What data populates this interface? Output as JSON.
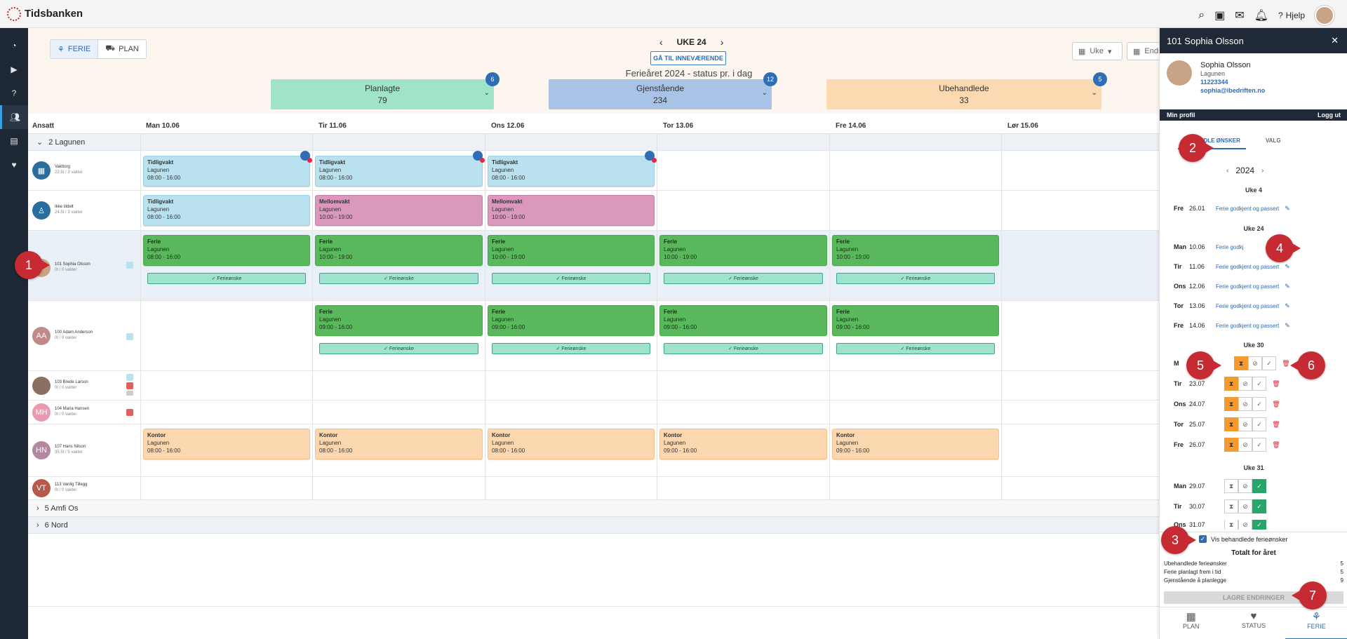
{
  "app": {
    "brand": "Tidsbanken",
    "help": "Hjelp"
  },
  "toolbar": {
    "ferie": "FERIE",
    "plan": "PLAN",
    "week": "UKE 24",
    "goto": "GÅ TIL INNEVÆRENDE",
    "heading": "Ferieåret 2024 - status pr. i dag",
    "view_select": "Uke",
    "end_select": "Ends"
  },
  "stats": [
    {
      "label": "Planlagte",
      "value": "79",
      "badge": "6",
      "color": "#9fe3c9"
    },
    {
      "label": "Gjenstående",
      "value": "234",
      "badge": "12",
      "color": "#a9c3e6"
    },
    {
      "label": "Ubehandlede",
      "value": "33",
      "badge": "5",
      "color": "#fcd9b0"
    }
  ],
  "grid": {
    "col_employee": "Ansatt",
    "days": [
      "Man 10.06",
      "Tir 11.06",
      "Ons 12.06",
      "Tor 13.06",
      "Fre 14.06",
      "Lør 15.06"
    ],
    "groups": [
      "2 Lagunen",
      "5 Amfi Os",
      "6 Nord"
    ],
    "wish": "Ferieønske",
    "employees": [
      {
        "name": "Vakttorg",
        "sub": "22.5t / 3 vakter",
        "initials": ""
      },
      {
        "name": "Ikke tildelt",
        "sub": "24.5t / 3 vakter",
        "initials": ""
      },
      {
        "name": "101 Sophia Olsson",
        "sub": "0t / 0 vakter",
        "initials": ""
      },
      {
        "name": "100 Adam Anderson",
        "sub": "0t / 0 vakter",
        "initials": "AA"
      },
      {
        "name": "103 Brede Larson",
        "sub": "0t / 0 vakter",
        "initials": ""
      },
      {
        "name": "104 Maria Hansen",
        "sub": "0t / 0 vakter",
        "initials": "MH"
      },
      {
        "name": "107 Hans Nilson",
        "sub": "35.5t / 5 vakter",
        "initials": "HN"
      },
      {
        "name": "113 Vanlig Tillegg",
        "sub": "0t / 0 vakter",
        "initials": "VT"
      }
    ],
    "shifts": {
      "tidlig": {
        "title": "Tidligvakt",
        "place": "Lagunen",
        "time": "08:00 - 16:00"
      },
      "mellom": {
        "title": "Mellomvakt",
        "place": "Lagunen",
        "time": "10:00 - 19:00"
      },
      "ferie1": {
        "title": "Ferie",
        "place": "Lagunen",
        "time": "08:00 - 16:00"
      },
      "ferie2": {
        "title": "Ferie",
        "place": "Lagunen",
        "time": "10:00 - 19:00"
      },
      "ferie3": {
        "title": "Ferie",
        "place": "Lagunen",
        "time": "09:00 - 16:00"
      },
      "kontor1": {
        "title": "Kontor",
        "place": "Lagunen",
        "time": "08:00 - 16:00"
      },
      "kontor2": {
        "title": "Kontor",
        "place": "Lagunen",
        "time": "09:00 - 16:00"
      }
    }
  },
  "panel": {
    "title": "101 Sophia Olsson",
    "name": "Sophia Olsson",
    "dept": "Lagunen",
    "phone": "11223344",
    "email": "sophia@ibedriften.no",
    "my_profile": "Min profil",
    "logout": "Logg ut",
    "tab_active": "BEHANDLE ØNSKER",
    "tab_other": "VALG",
    "year": "2024",
    "status_text": "Ferie godkjent og passert",
    "status_short": "Ferie godkj",
    "weeks": [
      "Uke 4",
      "Uke 24",
      "Uke 30",
      "Uke 31"
    ],
    "w4": [
      {
        "d": "Fre",
        "dt": "26.01"
      }
    ],
    "w24": [
      {
        "d": "Man",
        "dt": "10.06"
      },
      {
        "d": "Tir",
        "dt": "11.06"
      },
      {
        "d": "Ons",
        "dt": "12.06"
      },
      {
        "d": "Tor",
        "dt": "13.06"
      },
      {
        "d": "Fre",
        "dt": "14.06"
      }
    ],
    "w30": [
      {
        "d": "M",
        "dt": ""
      },
      {
        "d": "Tir",
        "dt": "23.07"
      },
      {
        "d": "Ons",
        "dt": "24.07"
      },
      {
        "d": "Tor",
        "dt": "25.07"
      },
      {
        "d": "Fre",
        "dt": "26.07"
      }
    ],
    "w31": [
      {
        "d": "Man",
        "dt": "29.07"
      },
      {
        "d": "Tir",
        "dt": "30.07"
      },
      {
        "d": "Ons",
        "dt": "31.07"
      }
    ],
    "show_handled": "Vis behandlede ferieønsker",
    "total_title": "Totalt for året",
    "totals": [
      {
        "label": "Ubehandlede ferieønsker",
        "value": "5"
      },
      {
        "label": "Ferie planlagt frem i tid",
        "value": "5"
      },
      {
        "label": "Gjenstående å planlegge",
        "value": "9"
      }
    ],
    "save": "LAGRE ENDRINGER",
    "nav": [
      {
        "label": "PLAN"
      },
      {
        "label": "STATUS"
      },
      {
        "label": "FERIE"
      }
    ]
  },
  "markers": [
    "1",
    "2",
    "3",
    "4",
    "5",
    "6",
    "7"
  ]
}
